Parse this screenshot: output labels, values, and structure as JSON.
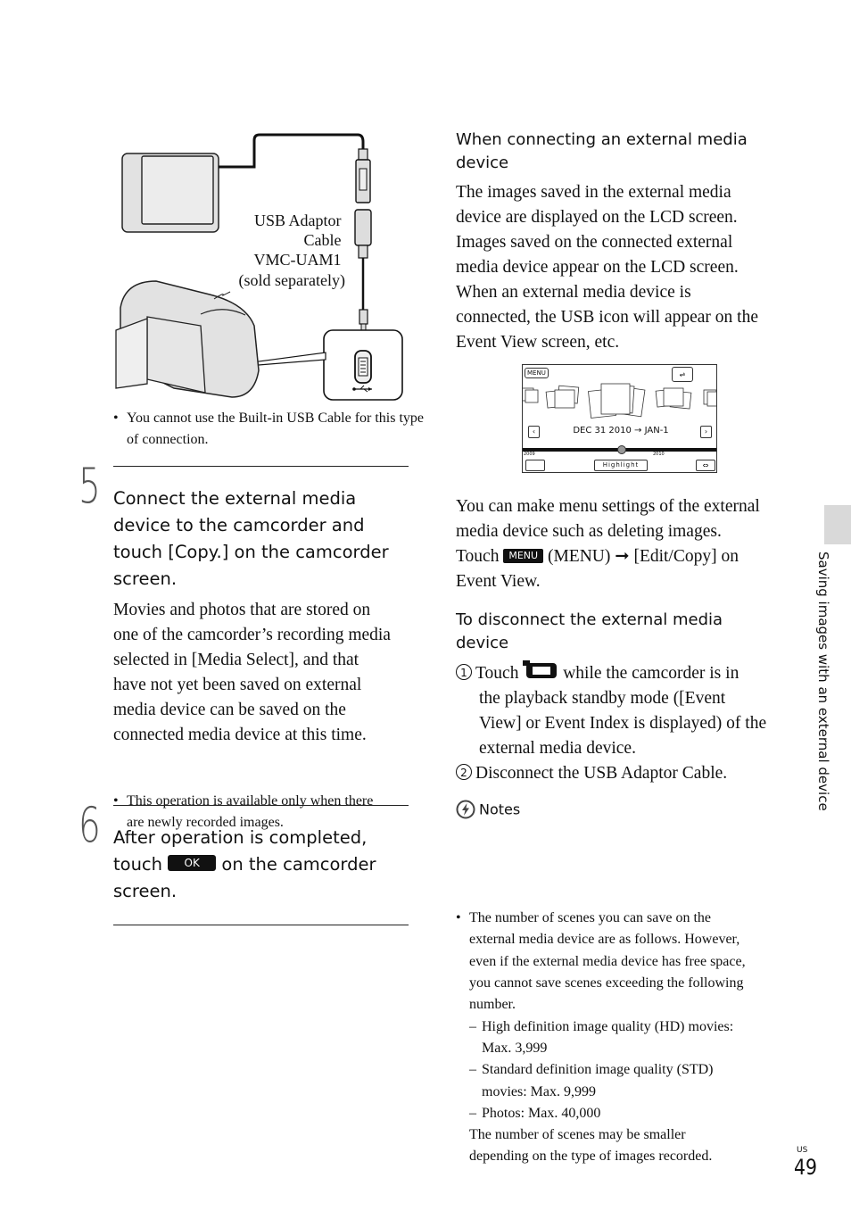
{
  "diagram": {
    "cable_label": [
      "USB Adaptor",
      "Cable",
      "VMC-UAM1",
      "(sold separately)"
    ],
    "note": "You cannot use the Built-in USB Cable for this type of connection."
  },
  "step5": {
    "number": "5",
    "title": [
      "Connect the external media",
      "device to the camcorder and",
      "touch [Copy.] on the camcorder",
      "screen."
    ],
    "body": [
      "Movies and photos that are stored on",
      "one of the camcorder’s recording media",
      "selected in [Media Select], and that",
      "have not yet been saved on external",
      "media device can be saved on the",
      "connected media device at this time."
    ],
    "note": [
      "This operation is available only when there",
      "are newly recorded images."
    ]
  },
  "step6": {
    "number": "6",
    "title_line1": "After operation is completed,",
    "title_line2_pre": "touch",
    "ok_label": "OK",
    "title_line2_post": "on the camcorder",
    "title_line3": "screen."
  },
  "right": {
    "heading1": [
      "When connecting an external media",
      "device"
    ],
    "para1": [
      "The images saved in the external media",
      "device are displayed on the LCD screen.",
      "Images saved on the connected external",
      "media device appear on the LCD screen.",
      "When an external media device is",
      "connected, the USB icon will appear on the",
      "Event View screen, etc."
    ],
    "screen": {
      "menu_label": "MENU",
      "date_label": "DEC 31 2010 → JAN-1",
      "year_left": "2009",
      "year_right": "2010",
      "highlight_label": "Highlight"
    },
    "para2": [
      "You can make menu settings of the external",
      "media device such as deleting images."
    ],
    "para2_touch": "Touch",
    "menu_btn": "MENU",
    "para2_rest": "(MENU) ➞ [Edit/Copy] on",
    "para2_last": "Event View.",
    "heading2": [
      "To disconnect the external media",
      "device"
    ],
    "step1_num": "1",
    "step1_pre": "Touch",
    "step1_post": "while the camcorder is in",
    "step1_lines": [
      "the playback standby mode ([Event",
      "View] or Event Index is displayed) of the",
      "external media device."
    ],
    "step2_num": "2",
    "step2": "Disconnect the USB Adaptor Cable.",
    "notes_label": "Notes",
    "notes_bullet": [
      "The number of scenes you can save on the",
      "external media device are as follows. However,",
      "even if the external media device has free space,",
      "you cannot save scenes exceeding the following",
      "number."
    ],
    "limits": [
      [
        "High definition image quality (HD) movies:",
        "Max. 3,999"
      ],
      [
        "Standard definition image quality (STD)",
        "movies: Max. 9,999"
      ],
      [
        "Photos: Max. 40,000"
      ]
    ],
    "notes_tail": [
      "The number of scenes may be smaller",
      "depending on the type of images recorded."
    ]
  },
  "side_tab_label": "Saving images with an external device",
  "footer": {
    "region": "US",
    "page": "49"
  }
}
